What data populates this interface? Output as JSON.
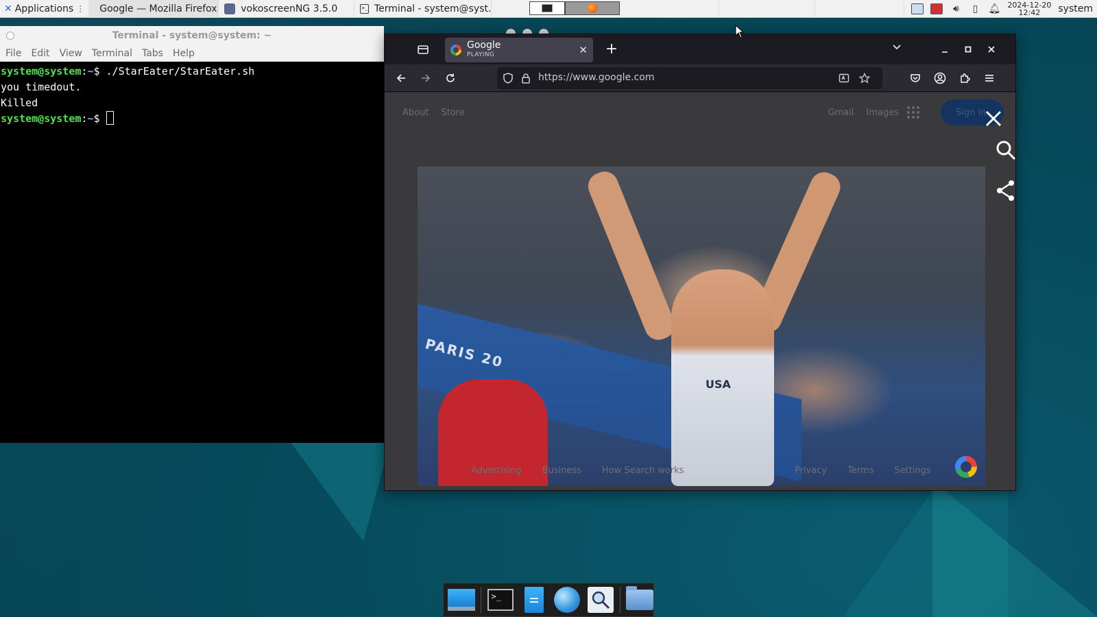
{
  "top_panel": {
    "applications_label": "Applications",
    "tasks": [
      {
        "label": "Google — Mozilla Firefox",
        "icon": "firefox-icon"
      },
      {
        "label": "vokoscreenNG 3.5.0",
        "icon": "vokoscreen-icon"
      },
      {
        "label": "Terminal - system@syst...",
        "icon": "terminal-icon"
      }
    ],
    "clock_date": "2024-12-20",
    "clock_time": "12:42",
    "user": "system"
  },
  "terminal": {
    "title": "Terminal - system@system: ~",
    "menu": [
      "File",
      "Edit",
      "View",
      "Terminal",
      "Tabs",
      "Help"
    ],
    "lines": [
      {
        "user": "system@system",
        "path": "~",
        "symbol": "$",
        "command": " ./StarEater/StarEater.sh"
      },
      {
        "output": "you timedout."
      },
      {
        "output": "Killed"
      },
      {
        "user": "system@system",
        "path": "~",
        "symbol": "$",
        "command": " "
      }
    ]
  },
  "firefox": {
    "tab_title": "Google",
    "tab_status": "PLAYING",
    "url": "https://www.google.com",
    "page": {
      "top_left_links": [
        "About",
        "Store"
      ],
      "top_right_links": [
        "Gmail",
        "Images"
      ],
      "signin_label": "Sign in",
      "doodle_board_text": "PARIS 20",
      "doodle_shirt_text": "USA",
      "footer_left": [
        "Advertising",
        "Business",
        "How Search works"
      ],
      "footer_right": [
        "Privacy",
        "Terms",
        "Settings"
      ]
    }
  },
  "dock": {
    "items": [
      "desktop-icon",
      "terminal-icon",
      "text-editor-icon",
      "web-browser-icon",
      "search-icon",
      "file-manager-icon"
    ]
  },
  "colors": {
    "prompt_user": "#4ee44e",
    "prompt_path": "#7ab0ff",
    "firefox_bg": "#2b2a33",
    "google_dark_bg": "#3a3a3c"
  }
}
